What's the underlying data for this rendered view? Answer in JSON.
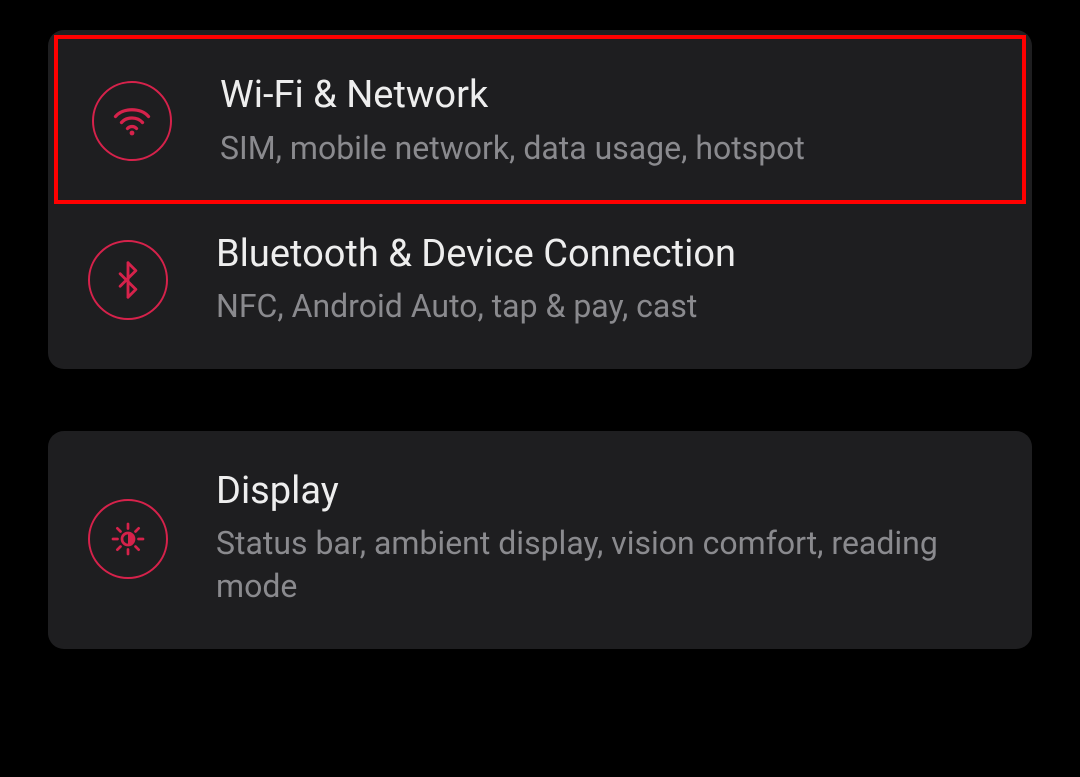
{
  "colors": {
    "accent": "#d6224b",
    "cardBg": "#1e1e20",
    "title": "#eeeeee",
    "subtitle": "#8a8a8e",
    "highlight": "#ff0000"
  },
  "groups": [
    {
      "items": [
        {
          "icon": "wifi-icon",
          "title": "Wi-Fi & Network",
          "subtitle": "SIM, mobile network, data usage, hotspot",
          "highlighted": true
        },
        {
          "icon": "bluetooth-icon",
          "title": "Bluetooth & Device Connection",
          "subtitle": "NFC, Android Auto, tap & pay, cast",
          "highlighted": false
        }
      ]
    },
    {
      "items": [
        {
          "icon": "brightness-icon",
          "title": "Display",
          "subtitle": "Status bar, ambient display, vision comfort, reading mode",
          "highlighted": false
        }
      ]
    }
  ]
}
